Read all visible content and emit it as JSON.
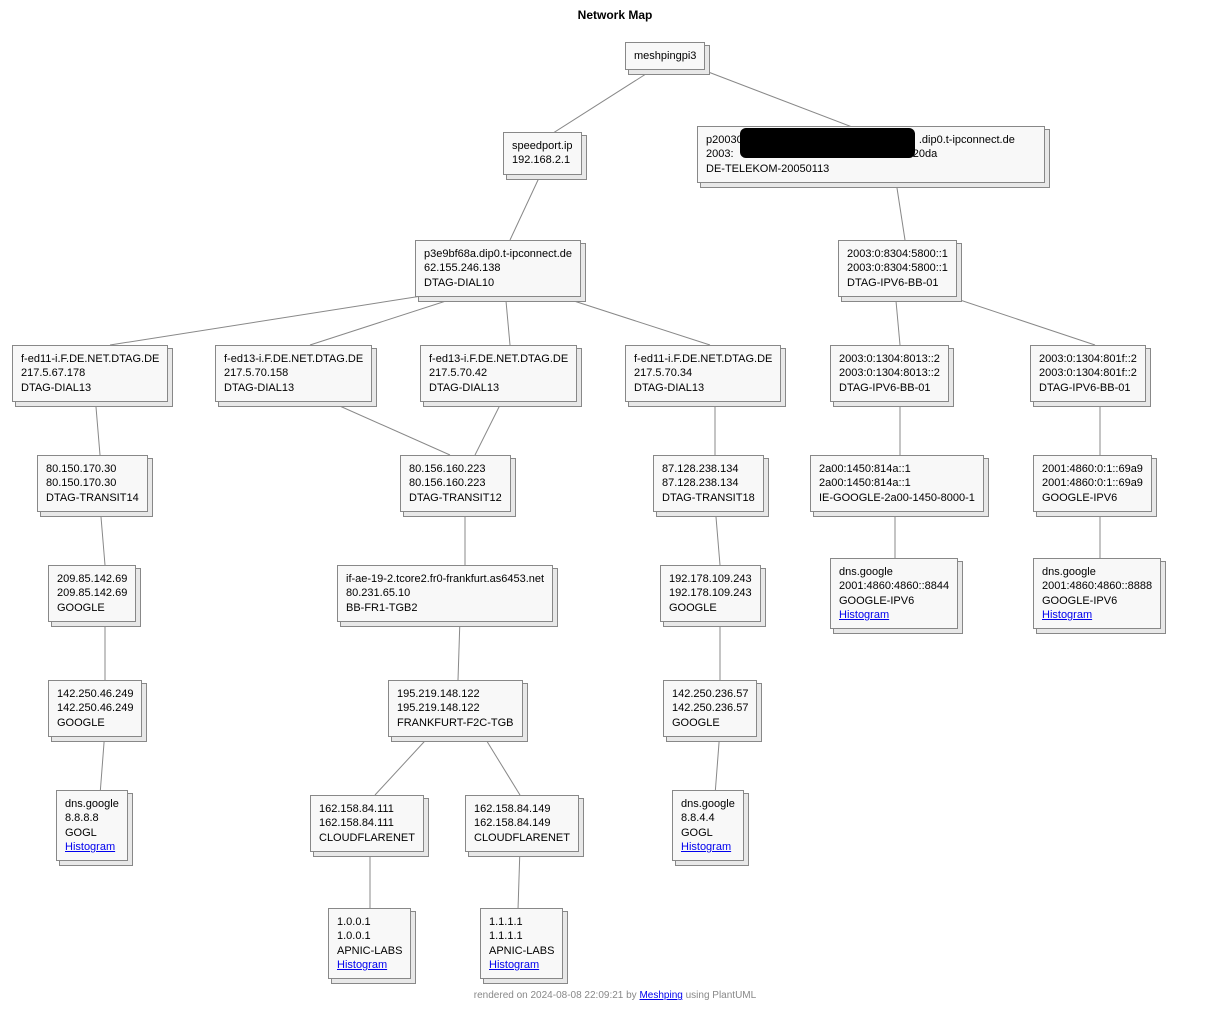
{
  "title": "Network Map",
  "footer": {
    "prefix": "rendered on 2024-08-08 22:09:21 by ",
    "link": "Meshping",
    "suffix": " using PlantUML"
  },
  "histogram_label": "Histogram",
  "nodes": {
    "root": {
      "l1": "meshpingpi3"
    },
    "speedport": {
      "l1": "speedport.ip",
      "l2": "192.168.2.1"
    },
    "p2003": {
      "l1_a": "p20030",
      "l1_b": ".dip0.t-ipconnect.de",
      "l2_a": "2003:",
      "l2_b": ":20da",
      "l3": "DE-TELEKOM-20050113"
    },
    "p3e": {
      "l1": "p3e9bf68a.dip0.t-ipconnect.de",
      "l2": "62.155.246.138",
      "l3": "DTAG-DIAL10"
    },
    "v6a": {
      "l1": "2003:0:8304:5800::1",
      "l2": "2003:0:8304:5800::1",
      "l3": "DTAG-IPV6-BB-01"
    },
    "fed11a": {
      "l1": "f-ed11-i.F.DE.NET.DTAG.DE",
      "l2": "217.5.67.178",
      "l3": "DTAG-DIAL13"
    },
    "fed13a": {
      "l1": "f-ed13-i.F.DE.NET.DTAG.DE",
      "l2": "217.5.70.158",
      "l3": "DTAG-DIAL13"
    },
    "fed13b": {
      "l1": "f-ed13-i.F.DE.NET.DTAG.DE",
      "l2": "217.5.70.42",
      "l3": "DTAG-DIAL13"
    },
    "fed11b": {
      "l1": "f-ed11-i.F.DE.NET.DTAG.DE",
      "l2": "217.5.70.34",
      "l3": "DTAG-DIAL13"
    },
    "v6b": {
      "l1": "2003:0:1304:8013::2",
      "l2": "2003:0:1304:8013::2",
      "l3": "DTAG-IPV6-BB-01"
    },
    "v6c": {
      "l1": "2003:0:1304:801f::2",
      "l2": "2003:0:1304:801f::2",
      "l3": "DTAG-IPV6-BB-01"
    },
    "t14": {
      "l1": "80.150.170.30",
      "l2": "80.150.170.30",
      "l3": "DTAG-TRANSIT14"
    },
    "t12": {
      "l1": "80.156.160.223",
      "l2": "80.156.160.223",
      "l3": "DTAG-TRANSIT12"
    },
    "t18": {
      "l1": "87.128.238.134",
      "l2": "87.128.238.134",
      "l3": "DTAG-TRANSIT18"
    },
    "ie": {
      "l1": "2a00:1450:814a::1",
      "l2": "2a00:1450:814a::1",
      "l3": "IE-GOOGLE-2a00-1450-8000-1"
    },
    "gv6": {
      "l1": "2001:4860:0:1::69a9",
      "l2": "2001:4860:0:1::69a9",
      "l3": "GOOGLE-IPV6"
    },
    "g1": {
      "l1": "209.85.142.69",
      "l2": "209.85.142.69",
      "l3": "GOOGLE"
    },
    "tcore": {
      "l1": "if-ae-19-2.tcore2.fr0-frankfurt.as6453.net",
      "l2": "80.231.65.10",
      "l3": "BB-FR1-TGB2"
    },
    "g2": {
      "l1": "192.178.109.243",
      "l2": "192.178.109.243",
      "l3": "GOOGLE"
    },
    "dnsg1": {
      "l1": "dns.google",
      "l2": "2001:4860:4860::8844",
      "l3": "GOOGLE-IPV6"
    },
    "dnsg2": {
      "l1": "dns.google",
      "l2": "2001:4860:4860::8888",
      "l3": "GOOGLE-IPV6"
    },
    "g3": {
      "l1": "142.250.46.249",
      "l2": "142.250.46.249",
      "l3": "GOOGLE"
    },
    "ftgb": {
      "l1": "195.219.148.122",
      "l2": "195.219.148.122",
      "l3": "FRANKFURT-F2C-TGB"
    },
    "g4": {
      "l1": "142.250.236.57",
      "l2": "142.250.236.57",
      "l3": "GOOGLE"
    },
    "dns8": {
      "l1": "dns.google",
      "l2": "8.8.8.8",
      "l3": "GOGL"
    },
    "cf1": {
      "l1": "162.158.84.111",
      "l2": "162.158.84.111",
      "l3": "CLOUDFLARENET"
    },
    "cf2": {
      "l1": "162.158.84.149",
      "l2": "162.158.84.149",
      "l3": "CLOUDFLARENET"
    },
    "dns4": {
      "l1": "dns.google",
      "l2": "8.8.4.4",
      "l3": "GOGL"
    },
    "ap1": {
      "l1": "1.0.0.1",
      "l2": "1.0.0.1",
      "l3": "APNIC-LABS"
    },
    "ap2": {
      "l1": "1.1.1.1",
      "l2": "1.1.1.1",
      "l3": "APNIC-LABS"
    }
  }
}
